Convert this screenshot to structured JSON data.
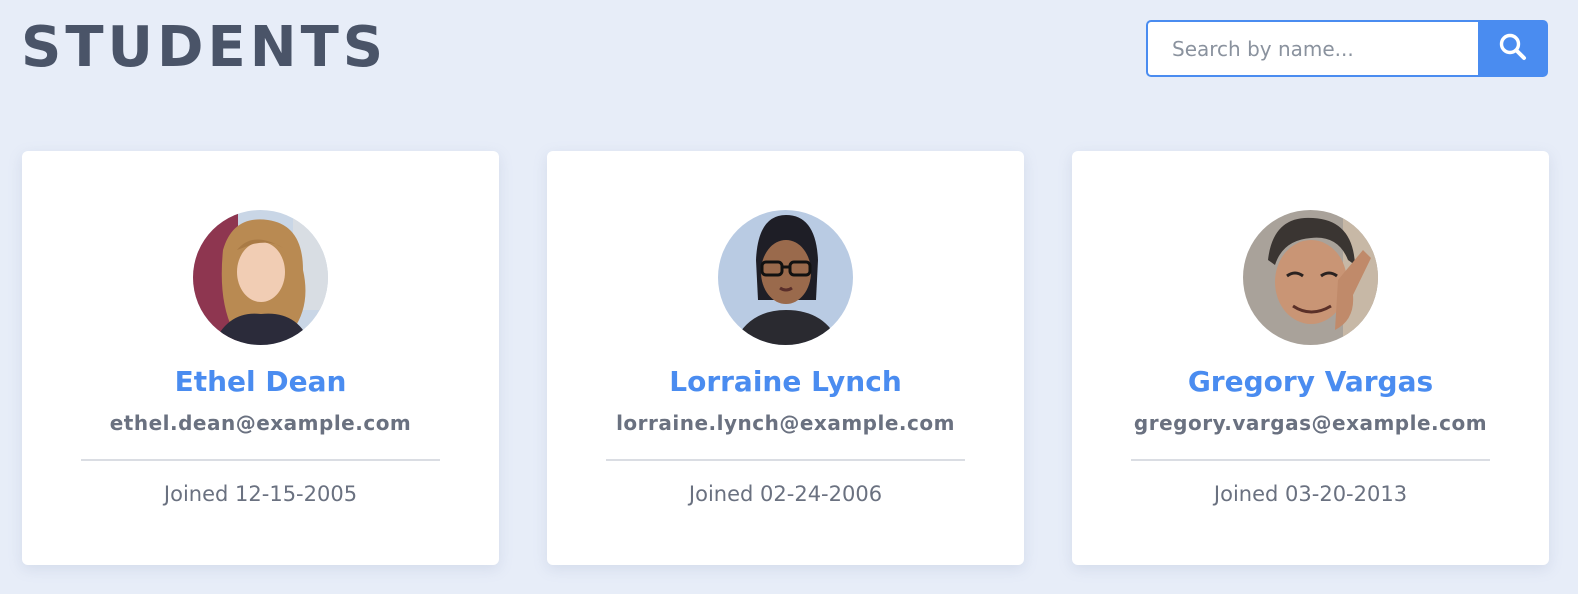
{
  "header": {
    "title": "STUDENTS"
  },
  "search": {
    "placeholder": "Search by name...",
    "value": "",
    "button_icon": "search-icon"
  },
  "colors": {
    "accent": "#4a8cf0",
    "background": "#e7edf8",
    "title": "#4a5468",
    "muted_text": "#6a7180"
  },
  "students": [
    {
      "name": "Ethel Dean",
      "email": "ethel.dean@example.com",
      "joined": "Joined 12-15-2005",
      "avatar": "avatar-photo-woman-curly-hair"
    },
    {
      "name": "Lorraine Lynch",
      "email": "lorraine.lynch@example.com",
      "joined": "Joined 02-24-2006",
      "avatar": "avatar-photo-woman-glasses"
    },
    {
      "name": "Gregory Vargas",
      "email": "gregory.vargas@example.com",
      "joined": "Joined 03-20-2013",
      "avatar": "avatar-photo-man-smiling"
    }
  ]
}
